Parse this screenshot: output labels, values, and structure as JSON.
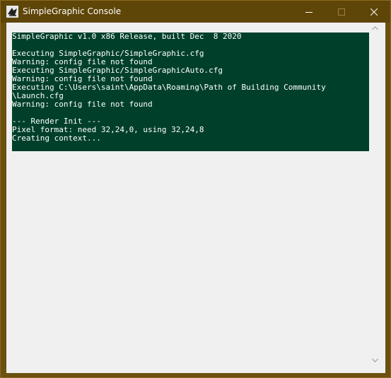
{
  "window": {
    "title": "SimpleGraphic Console",
    "app_icon": "simplegraphic-app-icon",
    "controls": {
      "minimize_icon": "minimize-icon",
      "maximize_icon": "maximize-icon",
      "close_icon": "close-icon"
    }
  },
  "console": {
    "background": "#00402a",
    "text_color": "#ffffff",
    "lines": [
      "SimpleGraphic v1.0 x86 Release, built Dec  8 2020",
      "",
      "Executing SimpleGraphic/SimpleGraphic.cfg",
      "Warning: config file not found",
      "Executing SimpleGraphic/SimpleGraphicAuto.cfg",
      "Warning: config file not found",
      "Executing C:\\Users\\saint\\AppData\\Roaming\\Path of Building Community",
      "\\Launch.cfg",
      "Warning: config file not found",
      "",
      "--- Render Init ---",
      "Pixel format: need 32,24,0, using 32,24,8",
      "Creating context..."
    ]
  },
  "scrollbar": {
    "up_icon": "scroll-up-icon",
    "down_icon": "scroll-down-icon"
  }
}
